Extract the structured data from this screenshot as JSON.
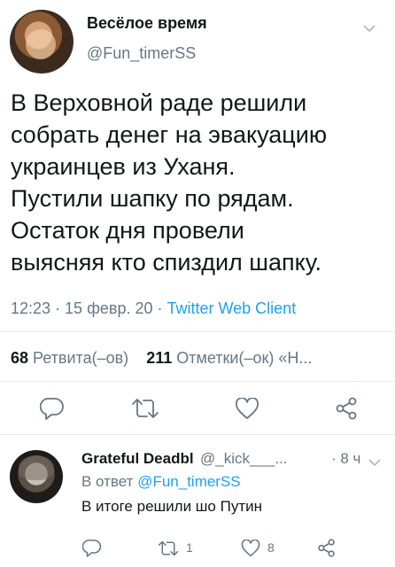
{
  "tweet": {
    "author_name": "Весёлое время",
    "author_handle": "@Fun_timerSS",
    "text_lines": [
      "В Верховной раде решили",
      "собрать денег на эвакуацию",
      "украинцев из Уханя.",
      "Пустили шапку по рядам.",
      "Остаток дня провели",
      "выясняя кто спиздил шапку."
    ],
    "meta_time": "12:23 · 15 февр. 20 · ",
    "meta_client": "Twitter Web Client",
    "retweets_count": "68",
    "retweets_label": "Ретвита(–ов)",
    "likes_count": "211",
    "likes_label": "Отметки(–ок) «Н..."
  },
  "reply": {
    "author_name": "Grateful Deadbl",
    "author_handle": "@_kick___...",
    "time": "· 8 ч",
    "replying_to_label": "В ответ",
    "replying_to_handle": "@Fun_timerSS",
    "text": "В итоге решили шо Путин",
    "retweets_count": "1",
    "likes_count": "8"
  },
  "icons": {
    "menu": "chevron-down-icon",
    "reply": "reply-icon",
    "retweet": "retweet-icon",
    "like": "heart-icon",
    "share": "share-icon"
  },
  "colors": {
    "accent": "#1da1f2",
    "secondary_text": "#657786",
    "primary_text": "#14171a",
    "divider": "#e1e8ed"
  }
}
